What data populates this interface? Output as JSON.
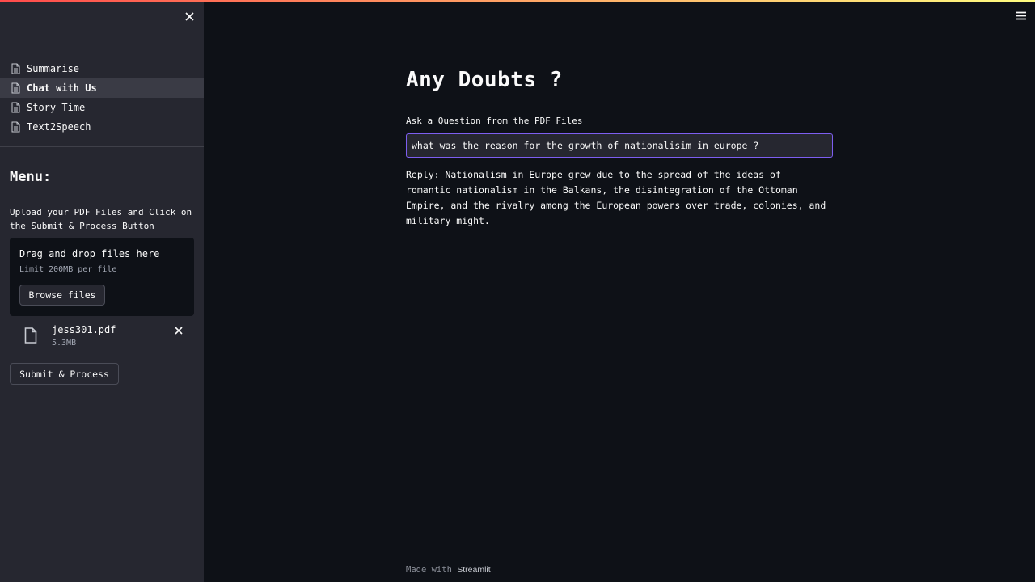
{
  "sidebar": {
    "nav": [
      {
        "label": "Summarise",
        "icon": "document-icon",
        "active": false
      },
      {
        "label": "Chat with Us",
        "icon": "document-icon",
        "active": true
      },
      {
        "label": "Story Time",
        "icon": "document-icon",
        "active": false
      },
      {
        "label": "Text2Speech",
        "icon": "document-icon",
        "active": false
      }
    ],
    "menu_title": "Menu:",
    "upload_instructions": "Upload your PDF Files and Click on the Submit & Process Button",
    "dropzone": {
      "title": "Drag and drop files here",
      "limit": "Limit 200MB per file",
      "browse_label": "Browse files"
    },
    "file": {
      "name": "jess301.pdf",
      "size": "5.3MB"
    },
    "submit_label": "Submit & Process"
  },
  "main": {
    "title": "Any Doubts ?",
    "question_label": "Ask a Question from the PDF Files",
    "question_value": "what was the reason for the growth of nationalisim in europe ?",
    "reply": "Reply: Nationalism in Europe grew due to the spread of the ideas of romantic nationalism in the Balkans, the disintegration of the Ottoman Empire, and the rivalry among the European powers over trade, colonies, and military might."
  },
  "footer": {
    "prefix": "Made with",
    "brand": "Streamlit"
  },
  "colors": {
    "background": "#0e1117",
    "sidebar": "#262730",
    "input_focus_border": "#7d5ef0",
    "text": "#fafafa"
  }
}
